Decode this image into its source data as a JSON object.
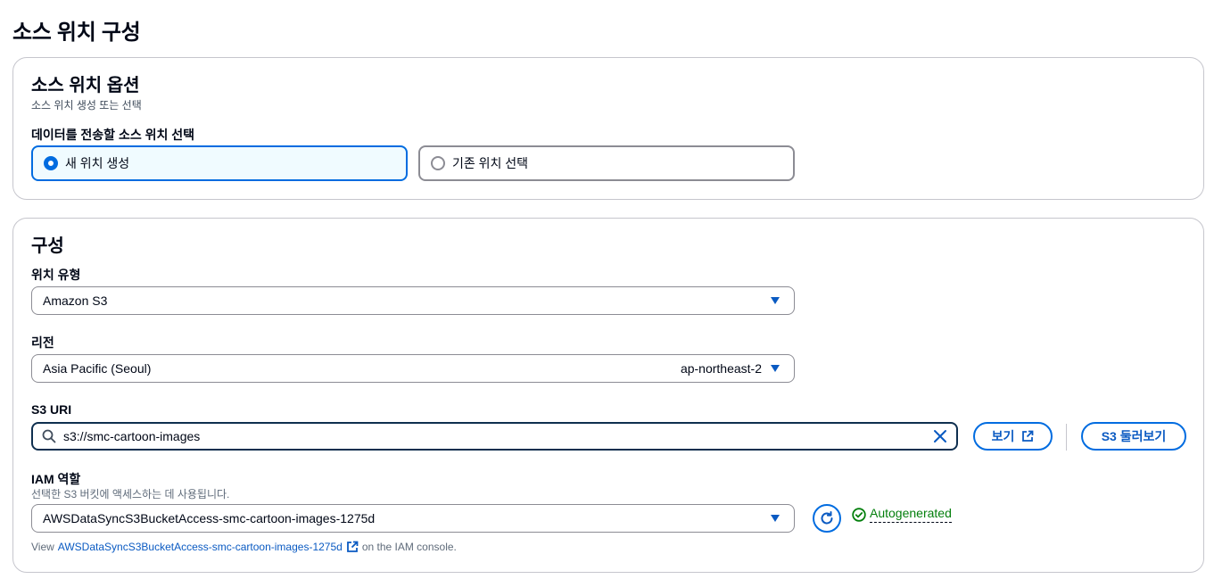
{
  "page_title": "소스 위치 구성",
  "source_options": {
    "title": "소스 위치 옵션",
    "description": "소스 위치 생성 또는 선택",
    "field_label": "데이터를 전송할 소스 위치 선택",
    "options": [
      {
        "label": "새 위치 생성",
        "selected": true
      },
      {
        "label": "기존 위치 선택",
        "selected": false
      }
    ]
  },
  "configuration": {
    "title": "구성",
    "location_type": {
      "label": "위치 유형",
      "value": "Amazon S3"
    },
    "region": {
      "label": "리전",
      "value": "Asia Pacific (Seoul)",
      "code": "ap-northeast-2"
    },
    "s3_uri": {
      "label": "S3 URI",
      "value": "s3://smc-cartoon-images",
      "view_button": "보기",
      "browse_button": "S3 둘러보기"
    },
    "iam_role": {
      "label": "IAM 역할",
      "description": "선택한 S3 버킷에 액세스하는 데 사용됩니다.",
      "value": "AWSDataSyncS3BucketAccess-smc-cartoon-images-1275d",
      "status": "Autogenerated",
      "console_prefix": "View",
      "console_link": "AWSDataSyncS3BucketAccess-smc-cartoon-images-1275d",
      "console_suffix": "on the IAM console."
    }
  },
  "colors": {
    "accent": "#006ce0",
    "link": "#0a5ac2",
    "success": "#037f0c",
    "border": "#8c8c94"
  }
}
